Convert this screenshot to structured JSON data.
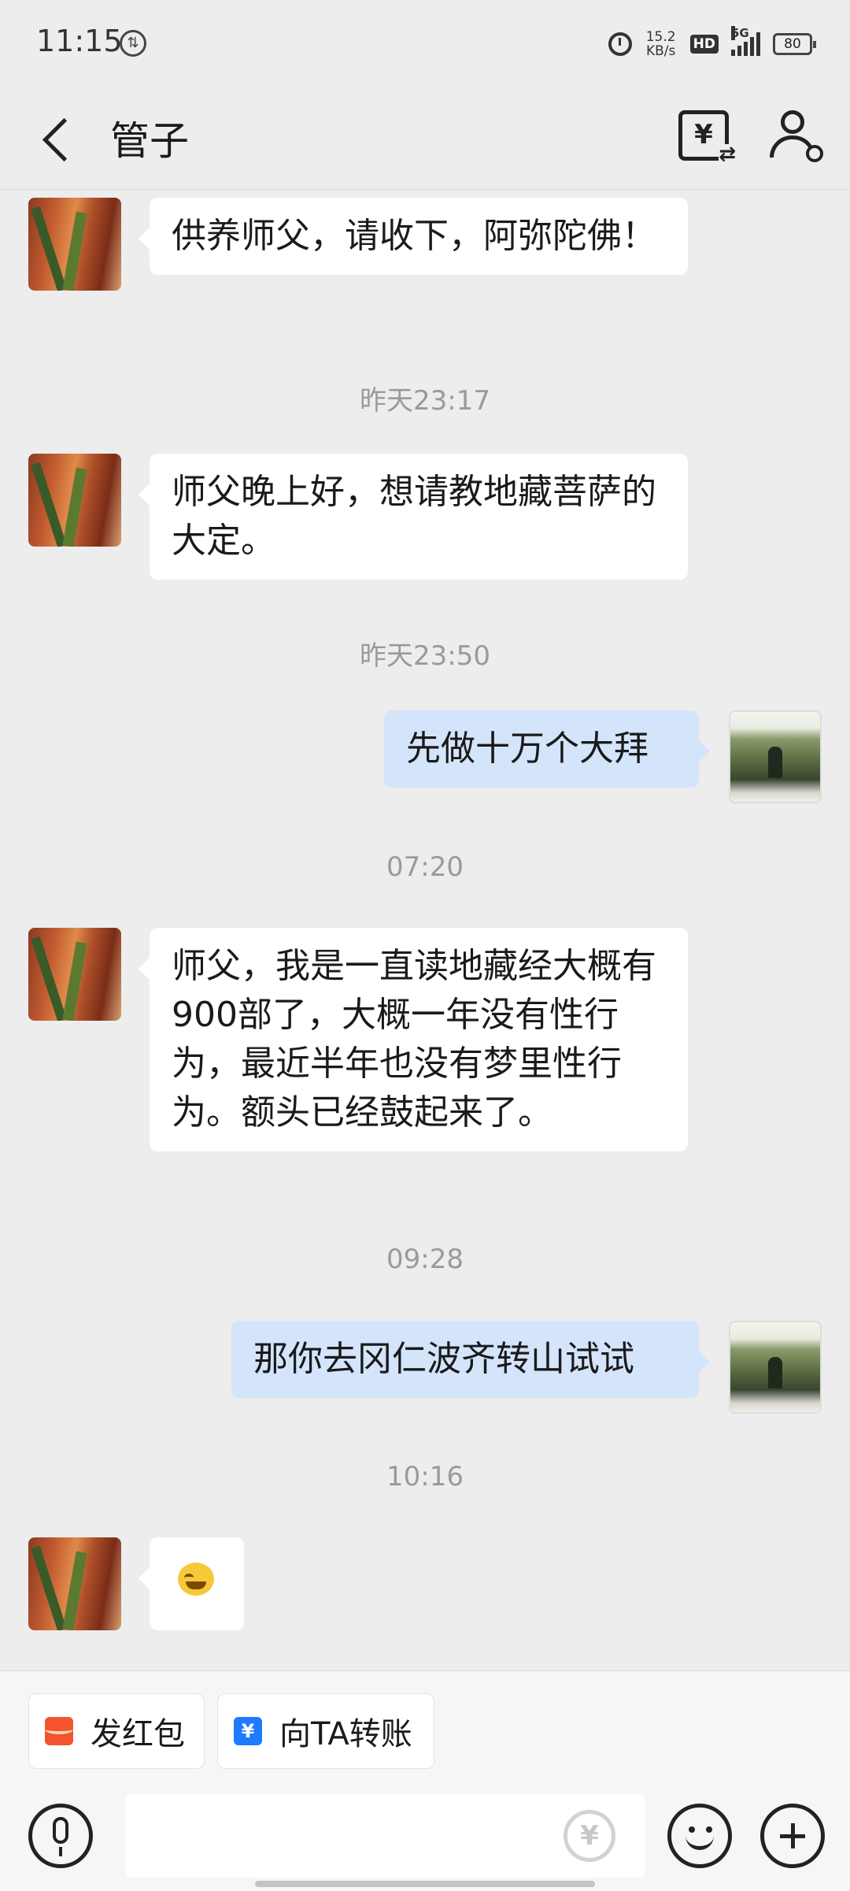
{
  "status_bar": {
    "time": "11:15",
    "net_speed_value": "15.2",
    "net_speed_unit": "KB/s",
    "hd_label": "HD",
    "network_label": "5G",
    "battery_level": "80"
  },
  "header": {
    "title": "管子"
  },
  "messages": [
    {
      "side": "left",
      "text": "供养师父，请收下，阿弥陀佛！"
    },
    {
      "timestamp": "昨天23:17"
    },
    {
      "side": "left",
      "text": "师父晚上好，想请教地藏菩萨的大定。"
    },
    {
      "timestamp": "昨天23:50"
    },
    {
      "side": "right",
      "text": "先做十万个大拜"
    },
    {
      "timestamp": "07:20"
    },
    {
      "side": "left",
      "text": "师父，我是一直读地藏经大概有900部了，大概一年没有性行为，最近半年也没有梦里性行为。额头已经鼓起来了。"
    },
    {
      "timestamp": "09:28"
    },
    {
      "side": "right",
      "text": "那你去冈仁波齐转山试试"
    },
    {
      "timestamp": "10:16"
    },
    {
      "side": "left",
      "emoji": "emoji-icon"
    }
  ],
  "actions": {
    "red_packet_label": "发红包",
    "transfer_label": "向TA转账",
    "transfer_icon_glyph": "¥"
  },
  "input": {
    "value": "",
    "yuan_glyph": "¥"
  },
  "colors": {
    "background": "#ededed",
    "incoming_bubble": "#ffffff",
    "outgoing_bubble": "#d4e4fb",
    "timestamp": "#9a9a9a",
    "red_packet": "#f3542f",
    "transfer": "#1e7bff"
  }
}
